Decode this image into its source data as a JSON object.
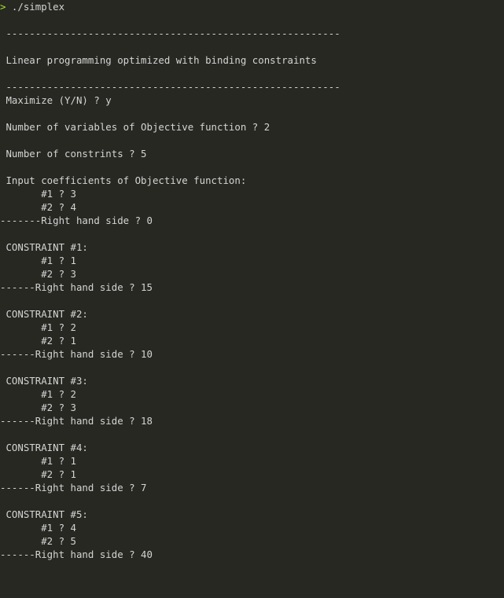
{
  "prompt": {
    "chevron": ">",
    "command": " ./simplex"
  },
  "output_lines": [
    " ---------------------------------------------------------",
    " Linear programming optimized with binding constraints",
    " ---------------------------------------------------------",
    " Maximize (Y/N) ? y",
    " Number of variables of Objective function ? 2",
    " Number of constrints ? 5",
    " Input coefficients of Objective function:",
    "       #1 ? 3",
    "       #2 ? 4",
    "-------Right hand side ? 0",
    " CONSTRAINT #1:",
    "       #1 ? 1",
    "       #2 ? 3",
    "------Right hand side ? 15",
    " CONSTRAINT #2:",
    "       #1 ? 2",
    "       #2 ? 1",
    "------Right hand side ? 10",
    " CONSTRAINT #3:",
    "       #1 ? 2",
    "       #2 ? 3",
    "------Right hand side ? 18",
    " CONSTRAINT #4:",
    "       #1 ? 1",
    "       #2 ? 1",
    "------Right hand side ? 7",
    " CONSTRAINT #5:",
    "       #1 ? 4",
    "       #2 ? 5",
    "------Right hand side ? 40"
  ],
  "colors": {
    "background": "#272822",
    "text": "#d4d4d4",
    "prompt_accent": "#a6e22e"
  }
}
